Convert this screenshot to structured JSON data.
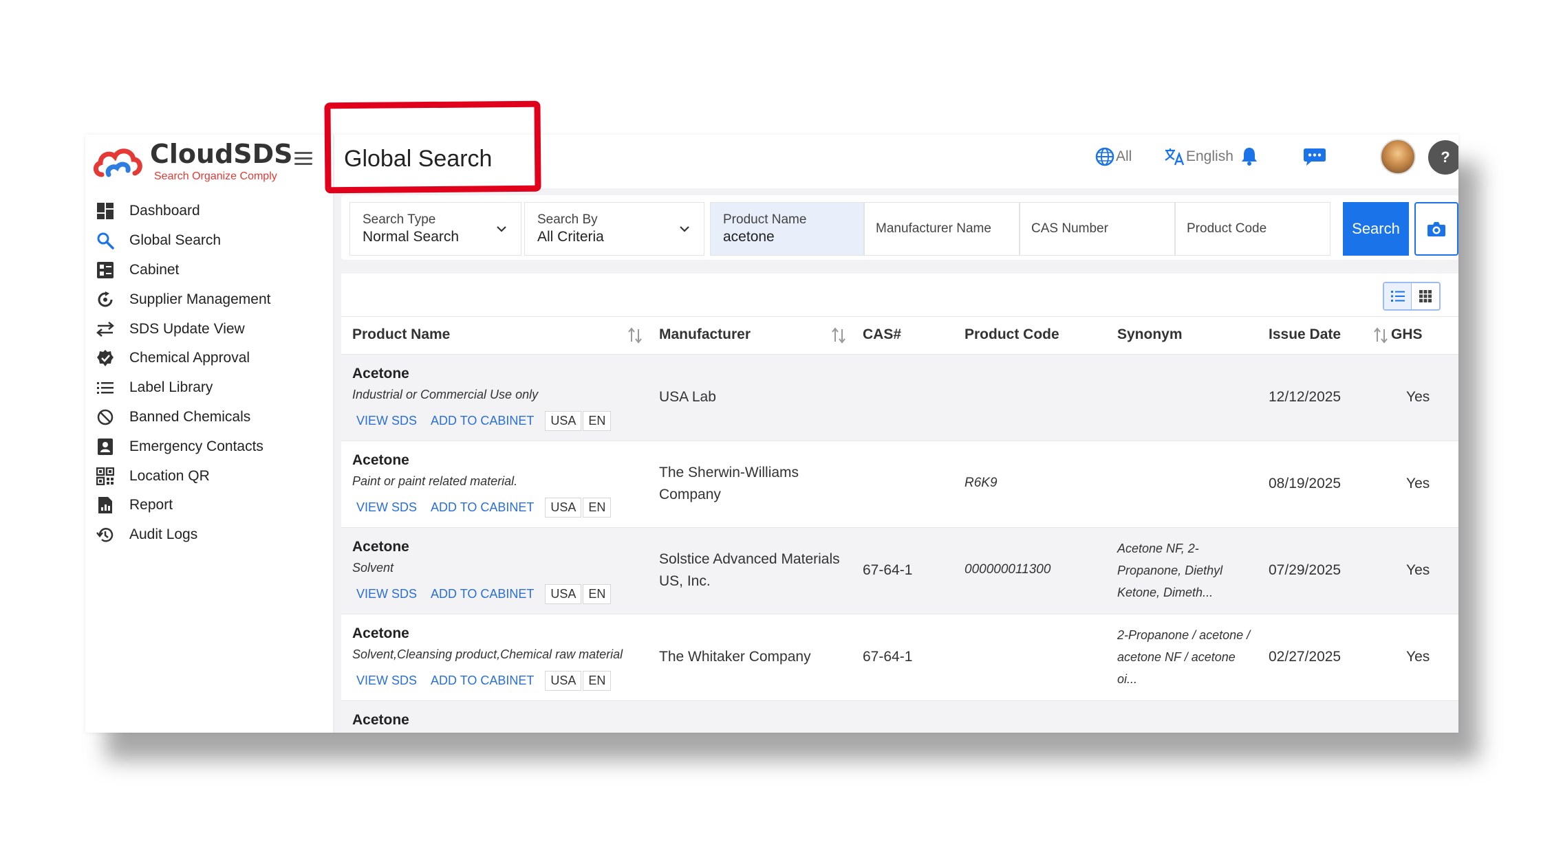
{
  "brand": {
    "name": "CloudSDS",
    "tagline": "Search Organize  Comply"
  },
  "sidebar": {
    "items": [
      {
        "label": "Dashboard",
        "icon": "dashboard-icon"
      },
      {
        "label": "Global Search",
        "icon": "search-icon"
      },
      {
        "label": "Cabinet",
        "icon": "cabinet-icon"
      },
      {
        "label": "Supplier Management",
        "icon": "supplier-icon"
      },
      {
        "label": "SDS Update View",
        "icon": "swap-arrows-icon"
      },
      {
        "label": "Chemical Approval",
        "icon": "approval-badge-icon"
      },
      {
        "label": "Label Library",
        "icon": "list-icon"
      },
      {
        "label": "Banned Chemicals",
        "icon": "banned-icon"
      },
      {
        "label": "Emergency Contacts",
        "icon": "contacts-icon"
      },
      {
        "label": "Location QR",
        "icon": "qr-code-icon"
      },
      {
        "label": "Report",
        "icon": "report-icon"
      },
      {
        "label": "Audit Logs",
        "icon": "history-icon"
      }
    ]
  },
  "header": {
    "title": "Global Search",
    "region_label": "All",
    "language_label": "English"
  },
  "search": {
    "search_type": {
      "label": "Search Type",
      "value": "Normal Search"
    },
    "search_by": {
      "label": "Search By",
      "value": "All Criteria"
    },
    "product_name": {
      "label": "Product Name",
      "value": "acetone"
    },
    "manufacturer_placeholder": "Manufacturer Name",
    "cas_placeholder": "CAS Number",
    "product_code_placeholder": "Product Code",
    "button_label": "Search"
  },
  "table": {
    "columns": {
      "product_name": "Product Name",
      "manufacturer": "Manufacturer",
      "cas": "CAS#",
      "product_code": "Product Code",
      "synonym": "Synonym",
      "issue_date": "Issue Date",
      "ghs": "GHS"
    },
    "actions": {
      "view": "VIEW SDS",
      "add": "ADD TO CABINET"
    },
    "rows": [
      {
        "name": "Acetone",
        "use": "Industrial or Commercial Use only",
        "region": "USA",
        "lang": "EN",
        "manufacturer": "USA Lab",
        "cas": "",
        "product_code": "",
        "synonym": "",
        "issue_date": "12/12/2025",
        "ghs": "Yes"
      },
      {
        "name": "Acetone",
        "use": "Paint or paint related material.",
        "region": "USA",
        "lang": "EN",
        "manufacturer": "The Sherwin-Williams Company",
        "cas": "",
        "product_code": "R6K9",
        "synonym": "",
        "issue_date": "08/19/2025",
        "ghs": "Yes"
      },
      {
        "name": "Acetone",
        "use": "Solvent",
        "region": "USA",
        "lang": "EN",
        "manufacturer": "Solstice Advanced Materials US, Inc.",
        "cas": "67-64-1",
        "product_code": "000000011300",
        "synonym": "Acetone NF, 2-Propanone, Diethyl Ketone, Dimeth...",
        "issue_date": "07/29/2025",
        "ghs": "Yes"
      },
      {
        "name": "Acetone",
        "use": "Solvent,Cleansing product,Chemical raw material",
        "region": "USA",
        "lang": "EN",
        "manufacturer": "The Whitaker Company",
        "cas": "67-64-1",
        "product_code": "",
        "synonym": "2-Propanone / acetone / acetone NF / acetone oi...",
        "issue_date": "02/27/2025",
        "ghs": "Yes"
      },
      {
        "name": "Acetone"
      }
    ]
  },
  "colors": {
    "accent": "#1a73e8",
    "highlight": "#e0001b",
    "brand_red": "#e53935"
  }
}
